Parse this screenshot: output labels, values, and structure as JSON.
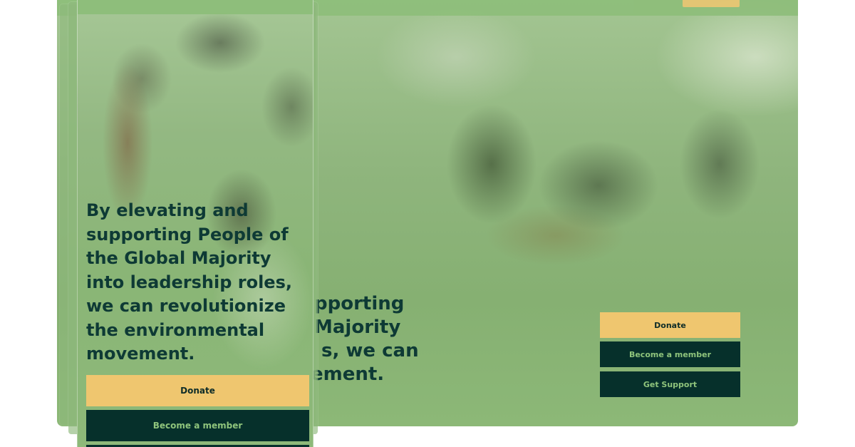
{
  "desktop": {
    "headline_lines": [
      "By elevating and",
      "supporting People of",
      "the Global Majority",
      "into leadership roles, we can",
      "revolutionize the environmental",
      "movement."
    ],
    "visible_headline_lines": [
      "pporting",
      "Majority",
      "s, we can",
      "",
      "ement."
    ],
    "buttons": {
      "donate": "Donate",
      "member": "Become a member",
      "support": "Get Support"
    }
  },
  "mobile": {
    "headline_lines": [
      "By elevating and",
      "supporting People of",
      "the Global Majority",
      "into leadership roles,",
      "we can revolutionize",
      "the environmental",
      "movement."
    ],
    "buttons": {
      "donate": "Donate",
      "member": "Become a member"
    }
  },
  "colors": {
    "accent_yellow": "#efc66f",
    "dark_green": "#06302b",
    "light_green_text": "#8fc47c",
    "headline": "#0e3a35",
    "overlay_green": "#8db979"
  }
}
